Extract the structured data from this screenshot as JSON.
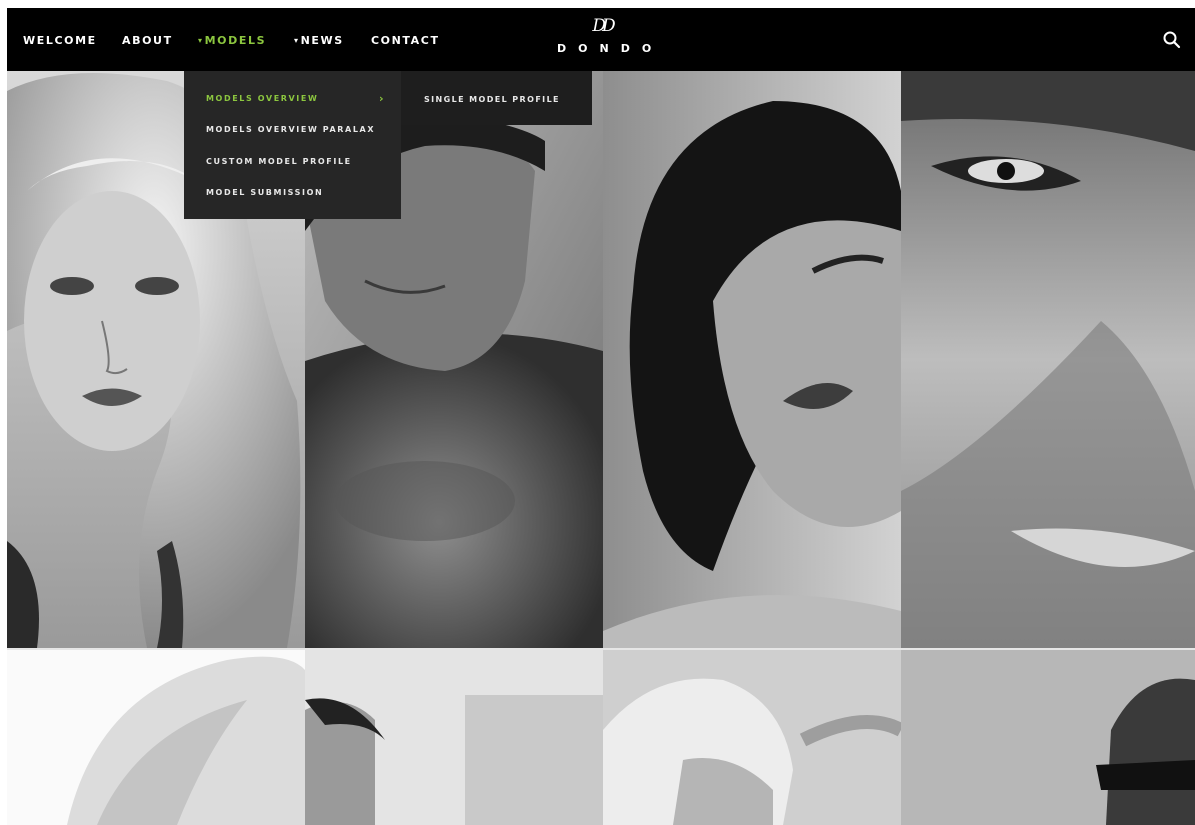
{
  "nav": {
    "items": [
      {
        "label": "WELCOME",
        "caret": false,
        "active": false
      },
      {
        "label": "ABOUT",
        "caret": false,
        "active": false
      },
      {
        "label": "MODELS",
        "caret": true,
        "active": true
      },
      {
        "label": "NEWS",
        "caret": true,
        "active": false
      },
      {
        "label": "CONTACT",
        "caret": false,
        "active": false
      }
    ],
    "caret_glyph": "▾",
    "search_icon": "search-icon"
  },
  "logo": {
    "mark": "DD",
    "text": "DONDO"
  },
  "dropdown": {
    "items": [
      {
        "label": "MODELS OVERVIEW",
        "active": true,
        "has_submenu": true
      },
      {
        "label": "MODELS OVERVIEW PARALAX",
        "active": false
      },
      {
        "label": "CUSTOM MODEL PROFILE",
        "active": false
      },
      {
        "label": "MODEL SUBMISSION",
        "active": false
      }
    ],
    "arrow_glyph": "›",
    "submenu": {
      "items": [
        {
          "label": "SINGLE MODEL PROFILE"
        }
      ]
    }
  },
  "colors": {
    "accent": "#8cc63f",
    "navbar": "#000000",
    "dropdown": "#262626"
  },
  "gallery": {
    "photos": [
      {
        "name": "photo-blonde-woman"
      },
      {
        "name": "photo-shirtless-man"
      },
      {
        "name": "photo-dark-haired-woman"
      },
      {
        "name": "photo-man-closeup"
      },
      {
        "name": "photo-blonde-hair-back"
      },
      {
        "name": "photo-man-profile"
      },
      {
        "name": "photo-curly-blonde-woman"
      },
      {
        "name": "photo-man-sunglasses"
      }
    ]
  }
}
